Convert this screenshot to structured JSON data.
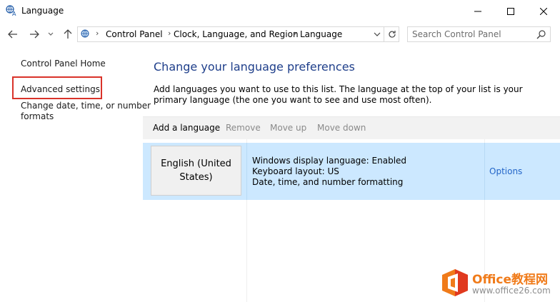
{
  "window": {
    "title": "Language",
    "app_icon": "language-globe-icon",
    "controls": [
      "minimize-icon",
      "maximize-icon",
      "close-icon"
    ]
  },
  "nav": {
    "back_icon": "arrow-left-icon",
    "forward_icon": "arrow-right-icon",
    "recent_icon": "chevron-down-icon",
    "up_icon": "arrow-up-icon",
    "breadcrumbs": [
      "Control Panel",
      "Clock, Language, and Region",
      "Language"
    ],
    "dropdown_icon": "chevron-down-icon",
    "refresh_icon": "refresh-icon",
    "search_placeholder": "Search Control Panel",
    "search_icon": "search-icon"
  },
  "sidebar": {
    "home": "Control Panel Home",
    "advanced": "Advanced settings",
    "date_line1": "Change date, time, or number",
    "date_line2": "formats"
  },
  "main": {
    "heading": "Change your language preferences",
    "description": "Add languages you want to use to this list. The language at the top of your list is your primary language (the one you want to see and use most often).",
    "toolbar": {
      "add": "Add a language",
      "remove": "Remove",
      "move_up": "Move up",
      "move_down": "Move down"
    },
    "languages": [
      {
        "name_line1": "English (United",
        "name_line2": "States)",
        "display": "Windows display language: Enabled",
        "keyboard": "Keyboard layout: US",
        "formatting": "Date, time, and number formatting",
        "options": "Options"
      }
    ]
  },
  "watermark": {
    "name": "Office教程网",
    "url": "www.office26.com",
    "colors": {
      "orange": "#f07b1a",
      "red": "#e0391f"
    }
  },
  "colors": {
    "heading": "#1e3e8a",
    "selection": "#cce8ff",
    "link": "#2365c8",
    "highlight_box": "#d9332a"
  }
}
